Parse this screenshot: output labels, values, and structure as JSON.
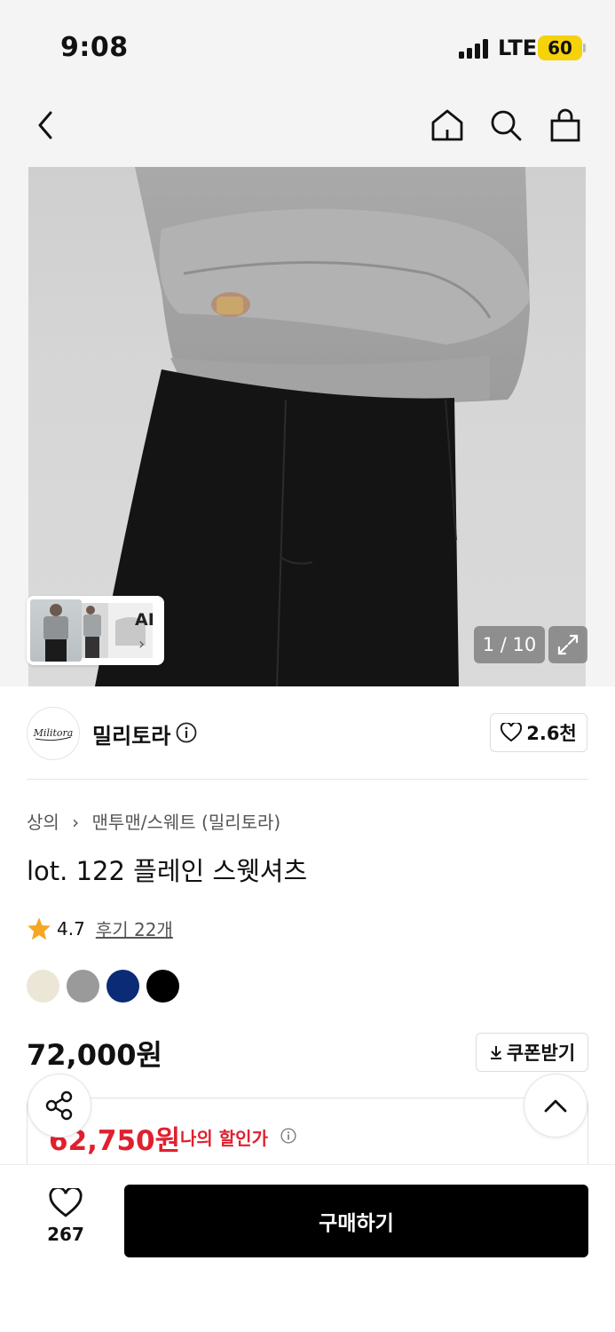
{
  "status": {
    "time": "9:08",
    "network": "LTE",
    "battery": "60"
  },
  "gallery": {
    "ai_label": "AI",
    "ai_chevron": "›",
    "page_indicator": "1 / 10"
  },
  "brand": {
    "name": "밀리토라",
    "logo_text": "Militora",
    "likes": "2.6천"
  },
  "product": {
    "breadcrumb": [
      "상의",
      "맨투맨/스웨트 (밀리토라)"
    ],
    "title": "lot. 122 플레인 스웻셔츠",
    "rating": "4.7",
    "review_link": "후기 22개",
    "swatch_colors": [
      "#ece6d6",
      "#9a9a9a",
      "#0c2b76",
      "#000000"
    ],
    "price": "72,000원",
    "coupon_label": "쿠폰받기",
    "discount_price": "62,750원",
    "discount_label": "나의 할인가"
  },
  "bottom": {
    "wish_count": "267",
    "buy_label": "구매하기"
  },
  "colors": {
    "accent_red": "#e0202e",
    "battery_yellow": "#f5d20a"
  }
}
